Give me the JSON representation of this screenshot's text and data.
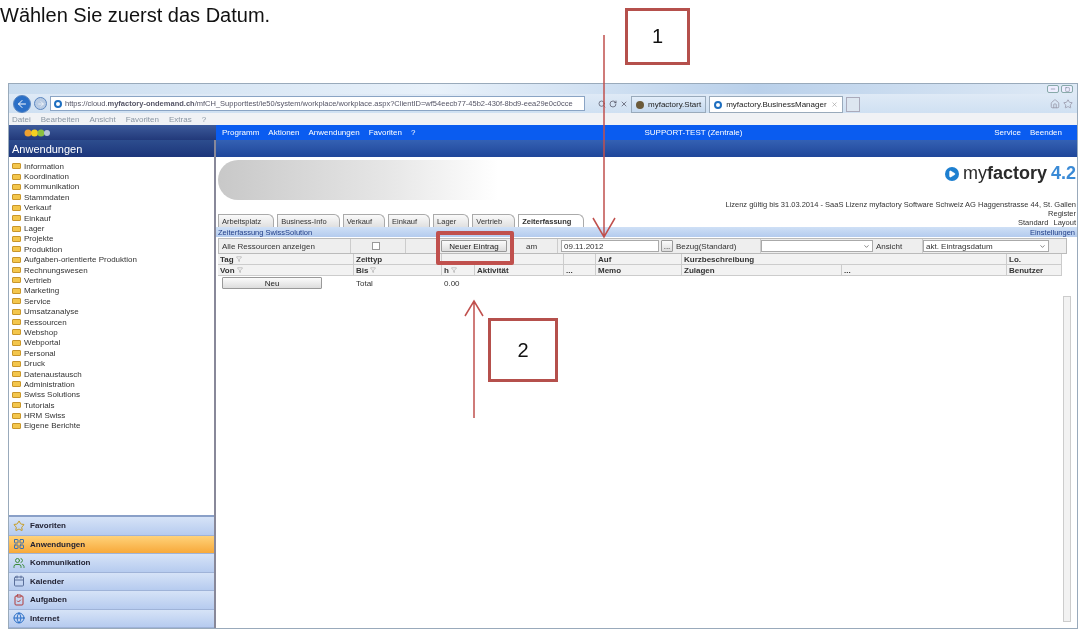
{
  "heading": "Wählen Sie zuerst das Datum.",
  "callouts": [
    {
      "label": "1"
    },
    {
      "label": "2"
    }
  ],
  "browser": {
    "url": "https://cloud.**myfactory-ondemand.ch**/mfCH_Supporttest/ie50/system/workplace/workplace.aspx?ClientID=wf54eecb77-45b2-430f-8bd9-eea29e0c0cce",
    "tabs": [
      {
        "title": "myfactory.Start",
        "selected": false
      },
      {
        "title": "myfactory.BusinessManager",
        "selected": true
      }
    ],
    "menu": [
      "Datei",
      "Bearbeiten",
      "Ansicht",
      "Favoriten",
      "Extras",
      "?"
    ]
  },
  "app": {
    "menu": [
      "Programm",
      "Aktionen",
      "Anwendungen",
      "Favoriten",
      "?"
    ],
    "company": "SUPPORT-TEST (Zentrale)",
    "right_menu": [
      "Service",
      "Beenden"
    ],
    "sidebar_title": "Anwendungen",
    "tree": [
      "Information",
      "Koordination",
      "Kommunikation",
      "Stammdaten",
      "Verkauf",
      "Einkauf",
      "Lager",
      "Projekte",
      "Produktion",
      "Aufgaben-orientierte Produktion",
      "Rechnungswesen",
      "Vertrieb",
      "Marketing",
      "Service",
      "Umsatzanalyse",
      "Ressourcen",
      "Webshop",
      "Webportal",
      "Personal",
      "Druck",
      "Datenaustausch",
      "Administration",
      "Swiss Solutions",
      "Tutorials",
      "HRM Swiss",
      "Eigene Berichte"
    ],
    "nav": [
      {
        "label": "Favoriten",
        "selected": false
      },
      {
        "label": "Anwendungen",
        "selected": true
      },
      {
        "label": "Kommunikation",
        "selected": false
      },
      {
        "label": "Kalender",
        "selected": false
      },
      {
        "label": "Aufgaben",
        "selected": false
      },
      {
        "label": "Internet",
        "selected": false
      }
    ],
    "brand": {
      "name": "my**factory**",
      "version": "4.2"
    },
    "license": "Lizenz gültig bis 31.03.2014 - SaaS Lizenz myfactory Software Schweiz AG Haggenstrasse 44, St. Gallen",
    "register": "Register",
    "layout_links": [
      "Standard",
      "Layout"
    ],
    "tabs": [
      {
        "label": "Arbeitsplatz",
        "selected": false
      },
      {
        "label": "Business-Info",
        "selected": false
      },
      {
        "label": "Verkauf",
        "selected": false
      },
      {
        "label": "Einkauf",
        "selected": false
      },
      {
        "label": "Lager",
        "selected": false
      },
      {
        "label": "Vertrieb",
        "selected": false
      },
      {
        "label": "Zeiterfassung",
        "selected": true
      }
    ],
    "section_title": "Zeiterfassung SwissSolution",
    "settings": "Einstellungen",
    "toolbar": {
      "show_all": "Alle Ressourcen anzeigen",
      "show_all_checked": false,
      "new_entry": "Neuer Eintrag",
      "date_label": "am",
      "date": "09.11.2012",
      "picker": "...",
      "reference": "Bezug(Standard)",
      "view_label": "Ansicht",
      "view": "akt. Eintragsdatum"
    },
    "header_row_1": [
      {
        "label": "Tag",
        "sortable": true
      },
      {
        "label": "Zeittyp",
        "sortable": false
      },
      {
        "label": "Auf",
        "sortable": false
      },
      {
        "label": "Kurzbeschreibung",
        "sortable": false
      },
      {
        "label": "Lo.",
        "sortable": false
      }
    ],
    "header_row_2": [
      {
        "label": "Von",
        "sortable": true
      },
      {
        "label": "Bis",
        "sortable": true
      },
      {
        "label": "h",
        "sortable": true
      },
      {
        "label": "Aktivität",
        "sortable": false
      },
      {
        "label": "...",
        "sortable": false
      },
      {
        "label": "Memo",
        "sortable": false
      },
      {
        "label": "Zulagen",
        "sortable": false
      },
      {
        "label": "...",
        "sortable": false
      },
      {
        "label": "Benutzer",
        "sortable": false
      }
    ],
    "total_row": {
      "button": "Neu",
      "label": "Total",
      "value": "0.00"
    }
  }
}
